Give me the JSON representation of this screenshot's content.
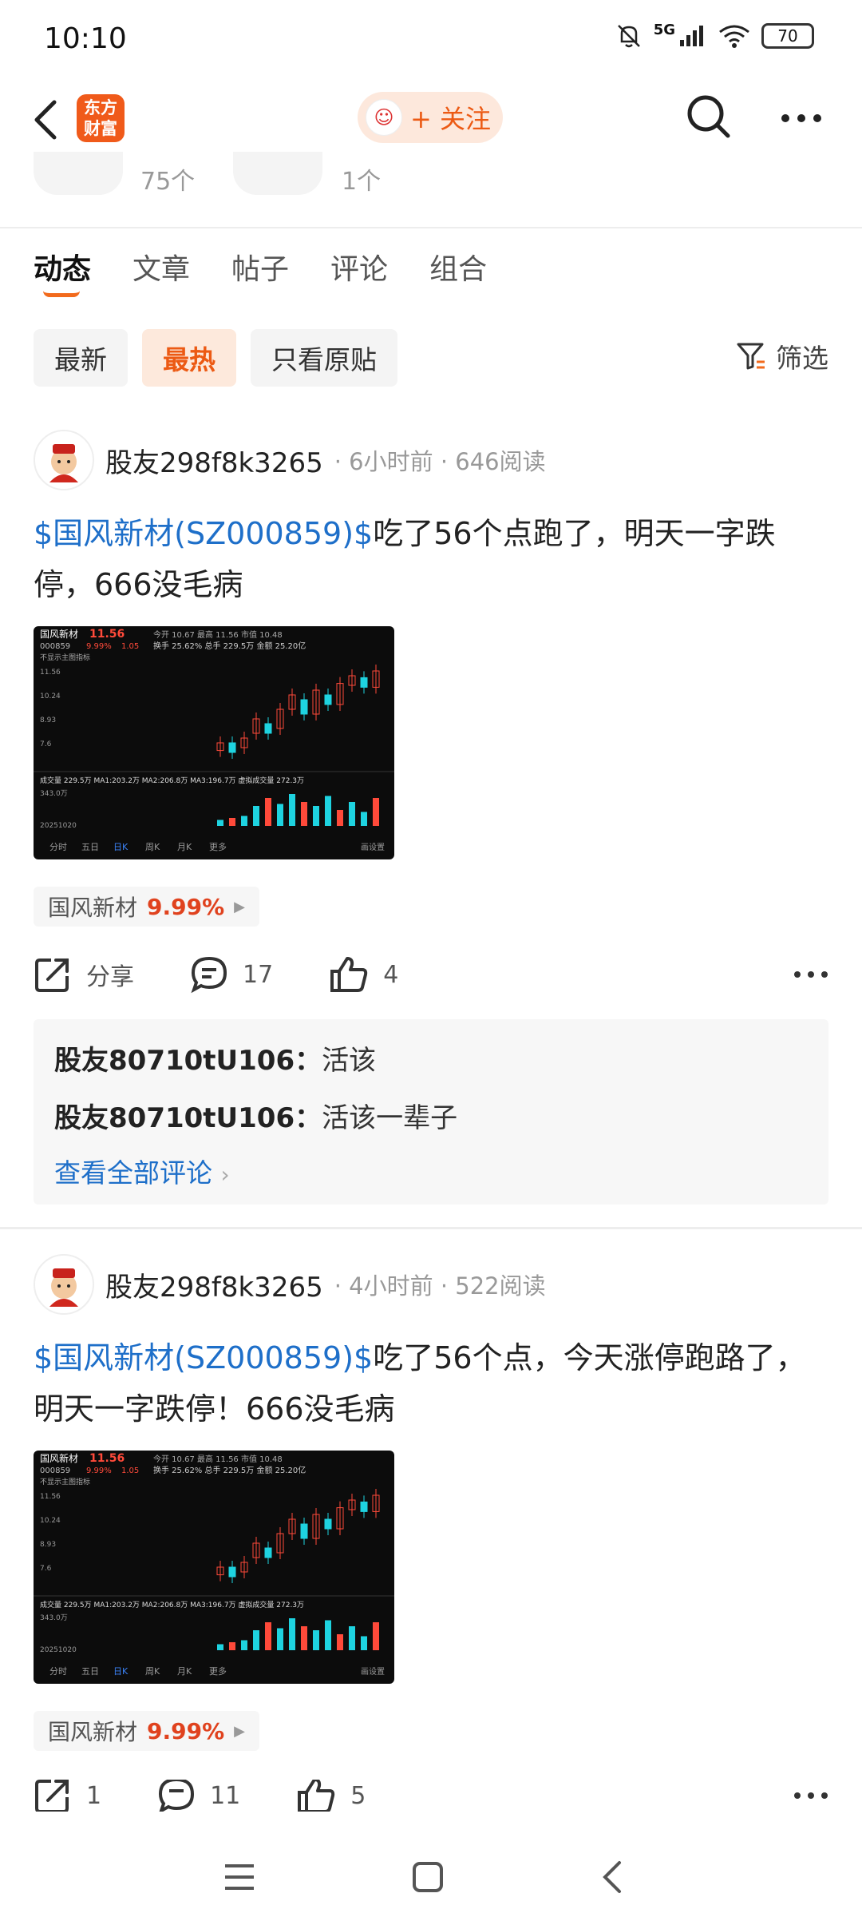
{
  "status": {
    "time": "10:10",
    "network": "5G",
    "battery": "70"
  },
  "header": {
    "logo_text": "东方财富",
    "follow_label": "+ 关注"
  },
  "prev_counts": [
    "75个",
    "1个"
  ],
  "tabs": [
    "动态",
    "文章",
    "帖子",
    "评论",
    "组合"
  ],
  "filters": {
    "chips": [
      "最新",
      "最热",
      "只看原贴"
    ],
    "filter_label": "筛选"
  },
  "posts": [
    {
      "author": "股友298f8k3265",
      "meta": "· 6小时前 · 646阅读",
      "stock_link": "$国风新材(SZ000859)$",
      "text": "吃了56个点跑了，明天一字跌停，666没毛病",
      "tag_name": "国风新材",
      "tag_pct": "9.99%",
      "share": "分享",
      "comments": "17",
      "likes": "4",
      "replies": [
        {
          "user": "股友80710tU106：",
          "text": "活该"
        },
        {
          "user": "股友80710tU106：",
          "text": "活该一辈子"
        }
      ],
      "view_all": "查看全部评论"
    },
    {
      "author": "股友298f8k3265",
      "meta": "· 4小时前 · 522阅读",
      "stock_link": "$国风新材(SZ000859)$",
      "text": "吃了56个点，今天涨停跑路了，明天一字跌停！666没毛病",
      "tag_name": "国风新材",
      "tag_pct": "9.99%",
      "share": "1",
      "comments": "11",
      "likes": "5"
    }
  ],
  "chart_snapshot": {
    "name": "国风新材",
    "price": "11.56",
    "code": "000859",
    "pct": "9.99%",
    "chg": "1.05",
    "row1": "今开 10.67 最高 11.56 市值 10.48",
    "row2": "换手 25.62% 总手 229.5万 金额 25.20亿",
    "subtitle": "不显示主图指标",
    "y_labels": [
      "11.56",
      "10.24",
      "8.93",
      "7.6"
    ],
    "vol_line": "成交量 229.5万 MA1:203.2万 MA2:206.8万 MA3:196.7万 虚拟成交量 272.3万",
    "vol_top": "343.0万",
    "date": "20251020",
    "tabs": [
      "分时",
      "五日",
      "日K",
      "周K",
      "月K",
      "更多"
    ],
    "settings": "画设置"
  }
}
